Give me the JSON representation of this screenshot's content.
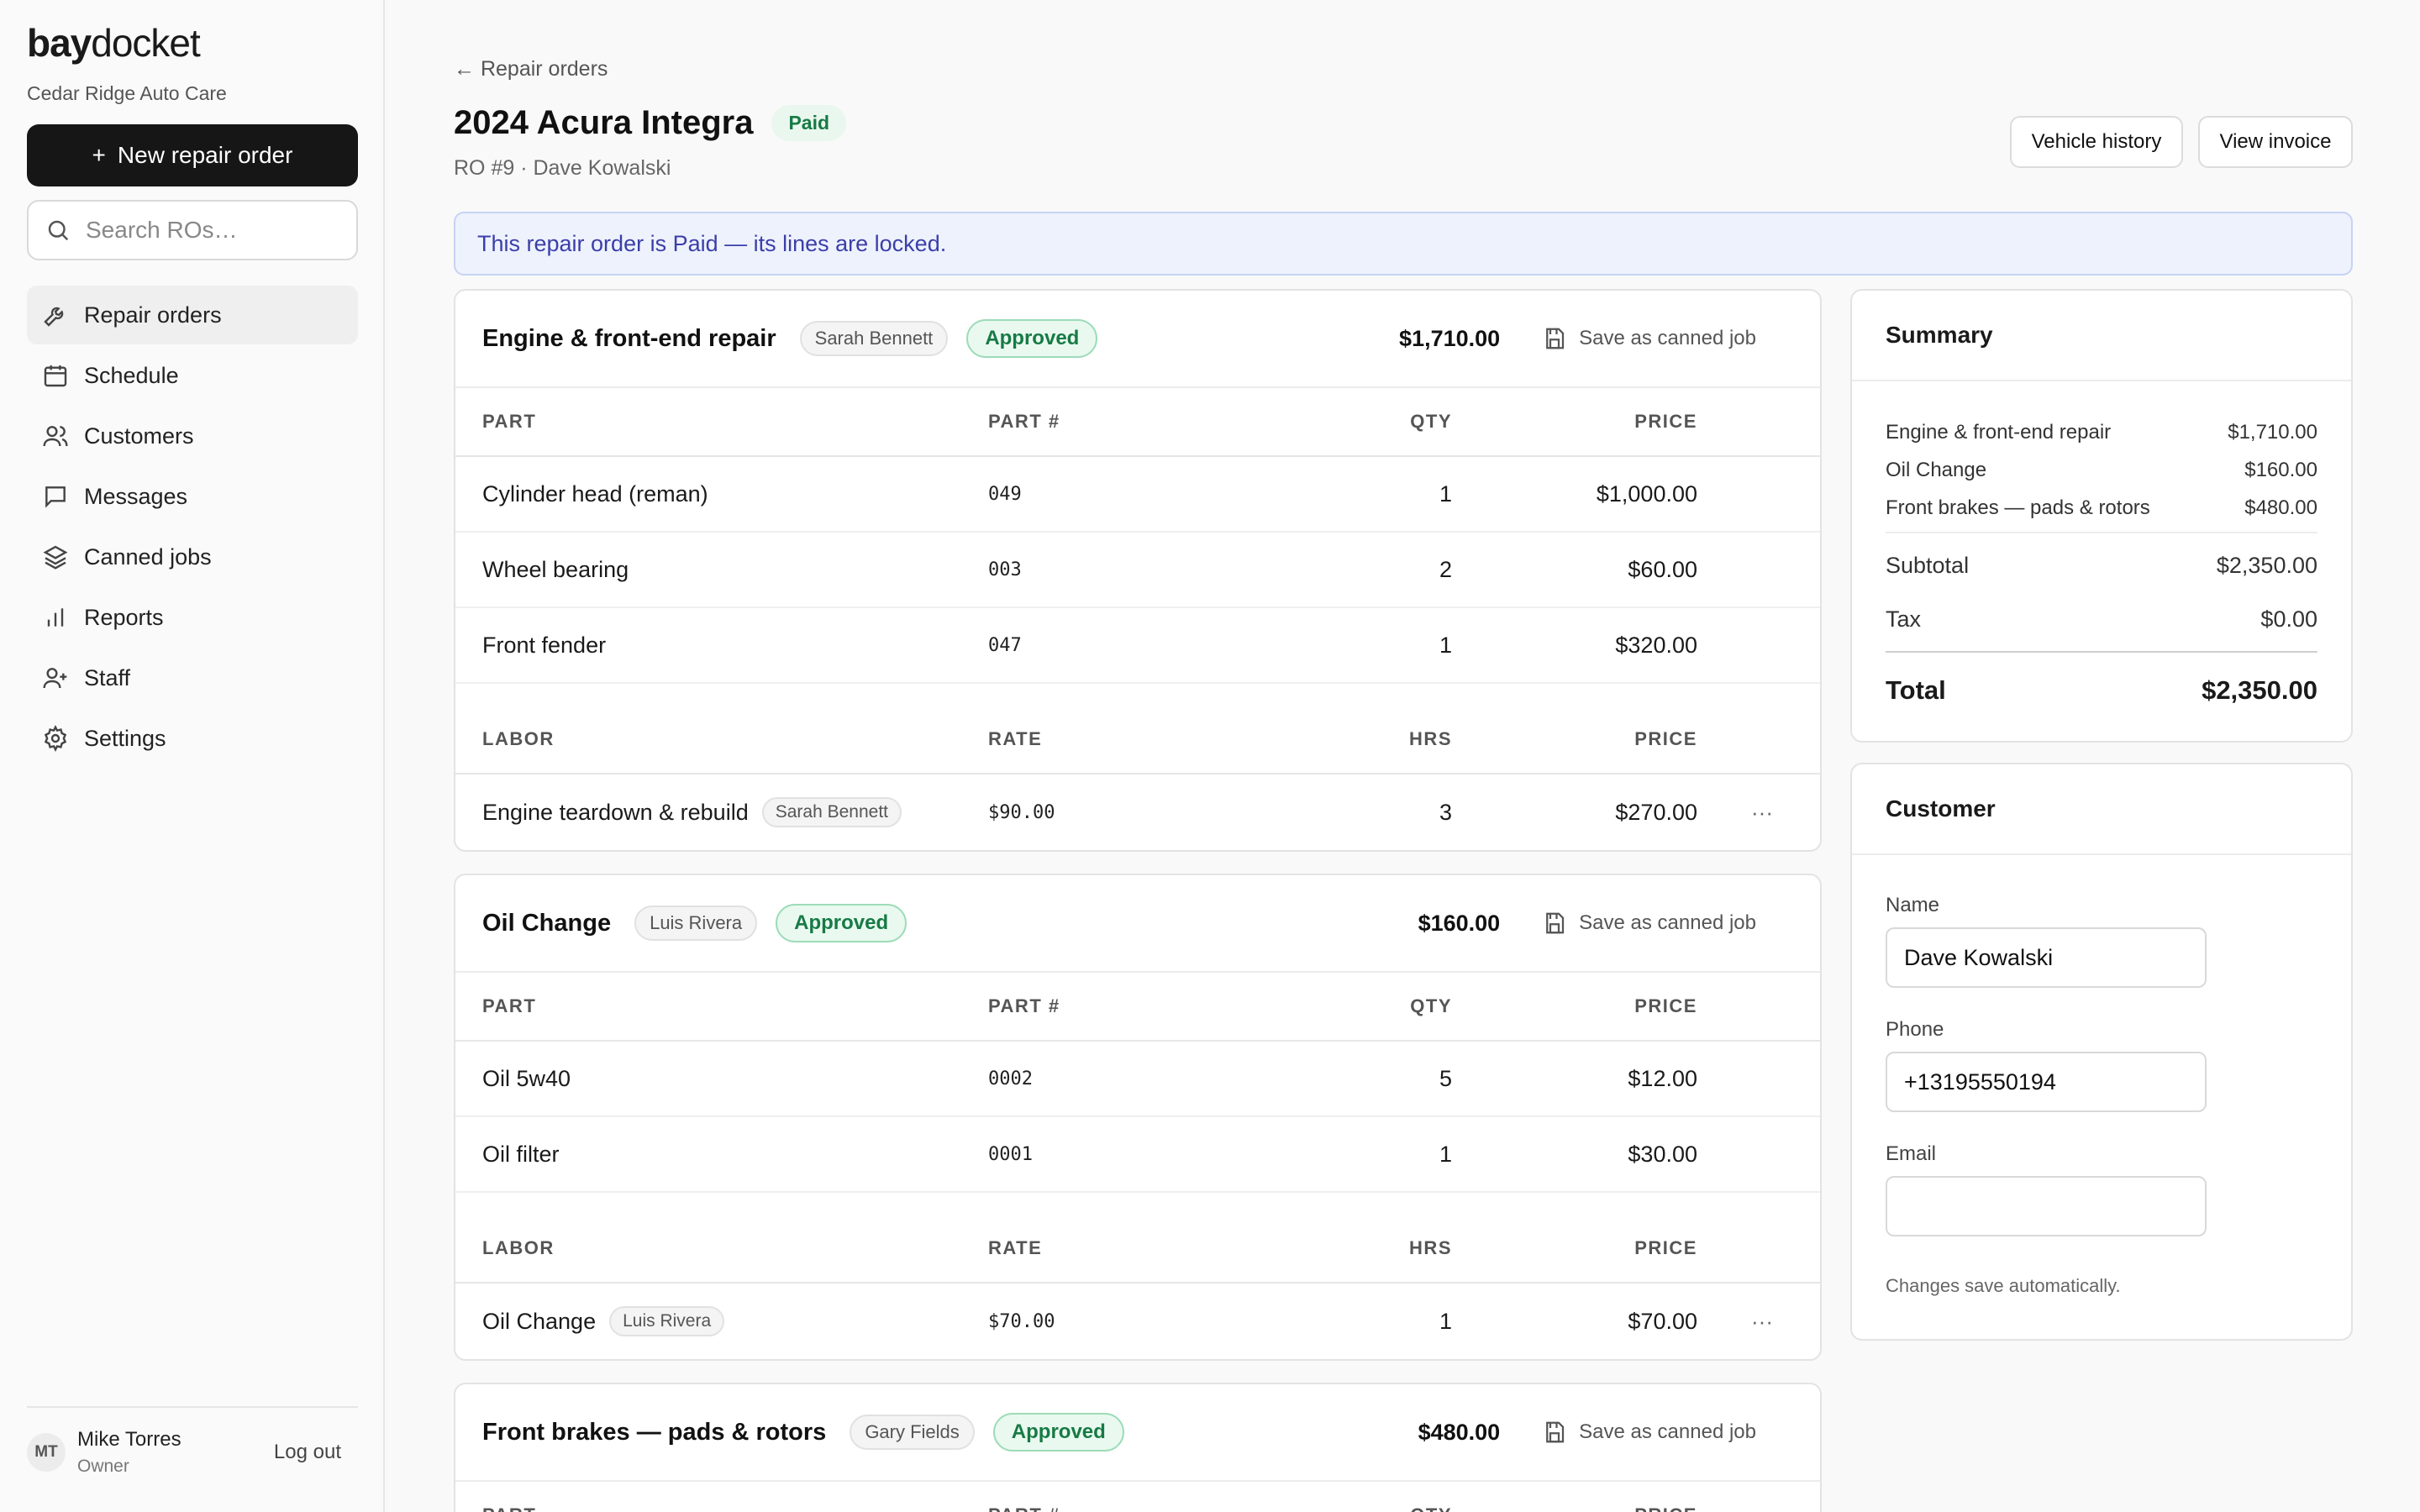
{
  "sidebar": {
    "brand_bold": "bay",
    "brand_rest": "docket",
    "shop_name": "Cedar Ridge Auto Care",
    "new_ro_label": "New repair order",
    "search_placeholder": "Search ROs…",
    "nav": [
      {
        "label": "Repair orders",
        "icon": "wrench-icon",
        "active": true
      },
      {
        "label": "Schedule",
        "icon": "calendar-icon"
      },
      {
        "label": "Customers",
        "icon": "users-icon"
      },
      {
        "label": "Messages",
        "icon": "message-icon"
      },
      {
        "label": "Canned jobs",
        "icon": "layers-icon"
      },
      {
        "label": "Reports",
        "icon": "bar-chart-icon"
      },
      {
        "label": "Staff",
        "icon": "user-plus-icon"
      },
      {
        "label": "Settings",
        "icon": "gear-icon"
      }
    ],
    "user": {
      "initials": "MT",
      "name": "Mike Torres",
      "role": "Owner",
      "logout_label": "Log out"
    }
  },
  "header": {
    "back_label": "Repair orders",
    "title": "2024 Acura Integra",
    "status": "Paid",
    "subtitle": "RO #9 · Dave Kowalski",
    "vehicle_history_label": "Vehicle history",
    "view_invoice_label": "View invoice"
  },
  "banner": "This repair order is Paid — its lines are locked.",
  "labels": {
    "part": "PART",
    "part_no": "PART #",
    "qty": "QTY",
    "price": "PRICE",
    "labor": "LABOR",
    "rate": "RATE",
    "hrs": "HRS",
    "save_canned": "Save as canned job",
    "approved": "Approved"
  },
  "jobs": [
    {
      "title": "Engine & front-end repair",
      "tech": "Sarah Bennett",
      "total": "$1,710.00",
      "parts": [
        {
          "name": "Cylinder head (reman)",
          "num": "049",
          "qty": "1",
          "price": "$1,000.00"
        },
        {
          "name": "Wheel bearing",
          "num": "003",
          "qty": "2",
          "price": "$60.00"
        },
        {
          "name": "Front fender",
          "num": "047",
          "qty": "1",
          "price": "$320.00"
        }
      ],
      "labor": [
        {
          "name": "Engine teardown & rebuild",
          "tech": "Sarah Bennett",
          "rate": "$90.00",
          "hrs": "3",
          "price": "$270.00"
        }
      ]
    },
    {
      "title": "Oil Change",
      "tech": "Luis Rivera",
      "total": "$160.00",
      "parts": [
        {
          "name": "Oil 5w40",
          "num": "0002",
          "qty": "5",
          "price": "$12.00"
        },
        {
          "name": "Oil filter",
          "num": "0001",
          "qty": "1",
          "price": "$30.00"
        }
      ],
      "labor": [
        {
          "name": "Oil Change",
          "tech": "Luis Rivera",
          "rate": "$70.00",
          "hrs": "1",
          "price": "$70.00"
        }
      ]
    },
    {
      "title": "Front brakes — pads & rotors",
      "tech": "Gary Fields",
      "total": "$480.00"
    }
  ],
  "summary": {
    "title": "Summary",
    "lines": [
      {
        "label": "Engine & front-end repair",
        "value": "$1,710.00"
      },
      {
        "label": "Oil Change",
        "value": "$160.00"
      },
      {
        "label": "Front brakes — pads & rotors",
        "value": "$480.00"
      }
    ],
    "subtotal_label": "Subtotal",
    "subtotal": "$2,350.00",
    "tax_label": "Tax",
    "tax": "$0.00",
    "total_label": "Total",
    "total": "$2,350.00"
  },
  "customer": {
    "title": "Customer",
    "name_label": "Name",
    "name": "Dave Kowalski",
    "phone_label": "Phone",
    "phone": "+13195550194",
    "email_label": "Email",
    "email": "",
    "note": "Changes save automatically."
  },
  "colors": {
    "accent_dark": "#161616",
    "paid_green": "#177a44",
    "banner_blue": "#3b3fa8"
  }
}
